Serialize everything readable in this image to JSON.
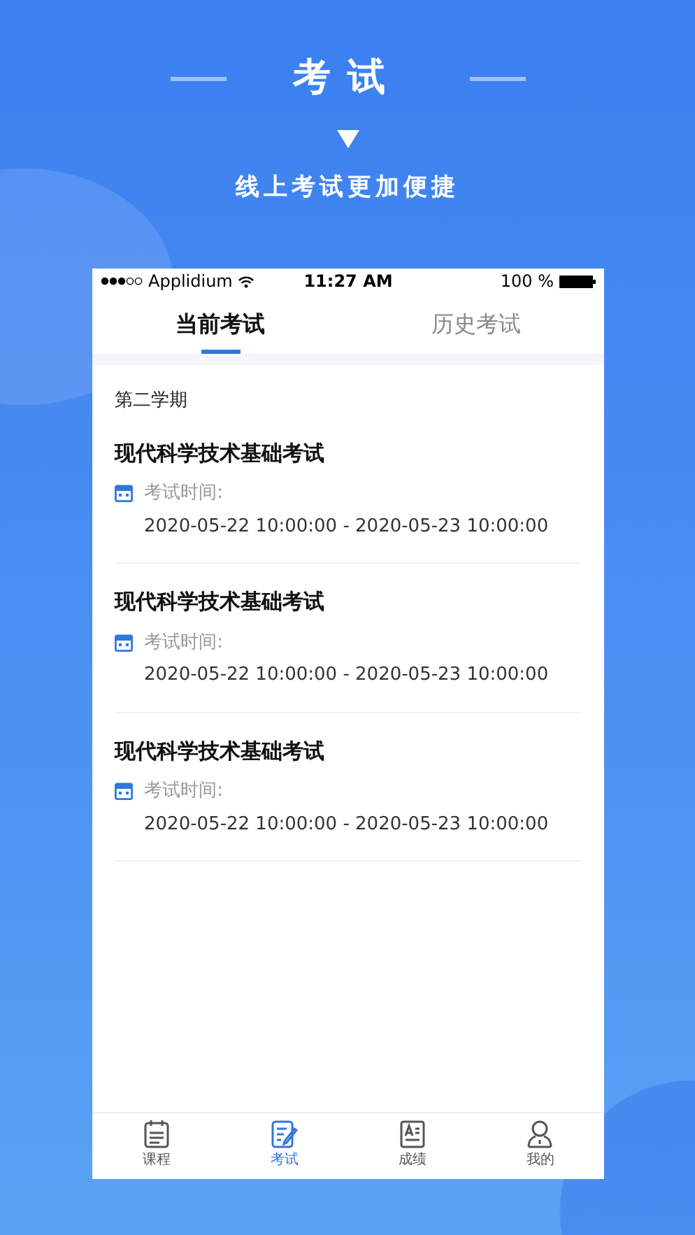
{
  "header": {
    "title": "考试",
    "subtitle": "线上考试更加便捷"
  },
  "status_bar": {
    "carrier": "Applidium",
    "time": "11:27 AM",
    "battery": "100 %"
  },
  "tabs": [
    {
      "label": "当前考试",
      "selected": true
    },
    {
      "label": "历史考试",
      "selected": false
    }
  ],
  "term": "第二学期",
  "exams": [
    {
      "title": "现代科学技术基础考试",
      "time_label": "考试时间:",
      "time_range": "2020-05-22 10:00:00 - 2020-05-23 10:00:00"
    },
    {
      "title": "现代科学技术基础考试",
      "time_label": "考试时间:",
      "time_range": "2020-05-22 10:00:00 - 2020-05-23 10:00:00"
    },
    {
      "title": "现代科学技术基础考试",
      "time_label": "考试时间:",
      "time_range": "2020-05-22 10:00:00 - 2020-05-23 10:00:00"
    }
  ],
  "bottom_nav": [
    {
      "kind": "course",
      "label": "课程",
      "selected": false
    },
    {
      "kind": "exam",
      "label": "考试",
      "selected": true
    },
    {
      "kind": "grade",
      "label": "成绩",
      "selected": false
    },
    {
      "kind": "profile",
      "label": "我的",
      "selected": false
    }
  ]
}
